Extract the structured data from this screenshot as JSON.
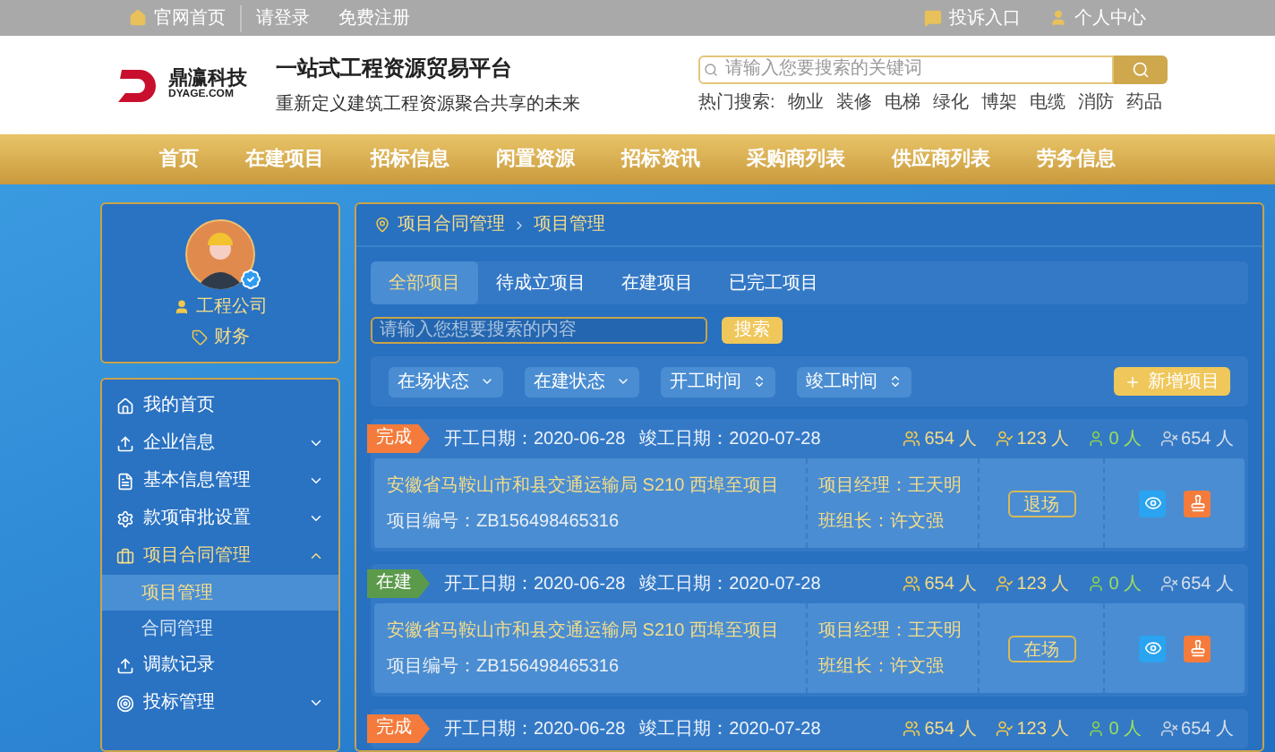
{
  "top_bar": {
    "left_links": [
      "官网首页",
      "请登录",
      "免费注册"
    ],
    "right_links": [
      "投诉入口",
      "个人中心"
    ]
  },
  "header": {
    "logo": {
      "name": "鼎瀛科技",
      "domain": "DYAGE.COM"
    },
    "title": "一站式工程资源贸易平台",
    "subtitle": "重新定义建筑工程资源聚合共享的未来",
    "search": {
      "placeholder": "请输入您要搜索的关键词"
    },
    "hot_search": {
      "label": "热门搜索:",
      "terms": [
        "物业",
        "装修",
        "电梯",
        "绿化",
        "博架",
        "电缆",
        "消防",
        "药品"
      ]
    }
  },
  "nav": {
    "items": [
      "首页",
      "在建项目",
      "招标信息",
      "闲置资源",
      "招标资讯",
      "采购商列表",
      "供应商列表",
      "劳务信息"
    ]
  },
  "profile": {
    "company": "工程公司",
    "role": "财务"
  },
  "sidebar": {
    "items": [
      {
        "label": "我的首页",
        "kind": "link"
      },
      {
        "label": "企业信息",
        "kind": "group",
        "expanded": false
      },
      {
        "label": "基本信息管理",
        "kind": "group",
        "expanded": false
      },
      {
        "label": "款项审批设置",
        "kind": "group",
        "expanded": false
      },
      {
        "label": "项目合同管理",
        "kind": "group",
        "expanded": true,
        "children": [
          {
            "label": "项目管理",
            "selected": true
          },
          {
            "label": "合同管理",
            "selected": false
          }
        ]
      },
      {
        "label": "调款记录",
        "kind": "link"
      },
      {
        "label": "投标管理",
        "kind": "group",
        "expanded": false
      }
    ]
  },
  "breadcrumb": [
    "项目合同管理",
    "项目管理"
  ],
  "tabs": [
    {
      "label": "全部项目",
      "selected": true
    },
    {
      "label": "待成立项目",
      "selected": false
    },
    {
      "label": "在建项目",
      "selected": false
    },
    {
      "label": "已完工项目",
      "selected": false
    }
  ],
  "search": {
    "placeholder": "请输入您想要搜索的内容",
    "button": "搜索"
  },
  "filters": [
    {
      "label": "在场状态",
      "kind": "dropdown"
    },
    {
      "label": "在建状态",
      "kind": "dropdown"
    },
    {
      "label": "开工时间",
      "kind": "sort"
    },
    {
      "label": "竣工时间",
      "kind": "sort"
    }
  ],
  "add_button": "新增项目",
  "projects": [
    {
      "status": "完成",
      "color": "#f47b3b",
      "start": "开工日期：2020-06-28",
      "end": "竣工日期：2020-07-28",
      "stats": [
        "654 人",
        "123 人",
        "0 人",
        "654 人"
      ],
      "name": "安徽省马鞍山市和县交通运输局 S210 西埠至项目",
      "code": "项目编号：ZB156498465316",
      "manager": "项目经理：王天明",
      "leader": "班组长：许文强",
      "action": "退场"
    },
    {
      "status": "在建",
      "color": "#5b9a4b",
      "start": "开工日期：2020-06-28",
      "end": "竣工日期：2020-07-28",
      "stats": [
        "654 人",
        "123 人",
        "0 人",
        "654 人"
      ],
      "name": "安徽省马鞍山市和县交通运输局 S210 西埠至项目",
      "code": "项目编号：ZB156498465316",
      "manager": "项目经理：王天明",
      "leader": "班组长：许文强",
      "action": "在场"
    },
    {
      "status": "完成",
      "color": "#f47b3b",
      "start": "开工日期：2020-06-28",
      "end": "竣工日期：2020-07-28",
      "stats": [
        "654 人",
        "123 人",
        "0 人",
        "654 人"
      ]
    }
  ]
}
